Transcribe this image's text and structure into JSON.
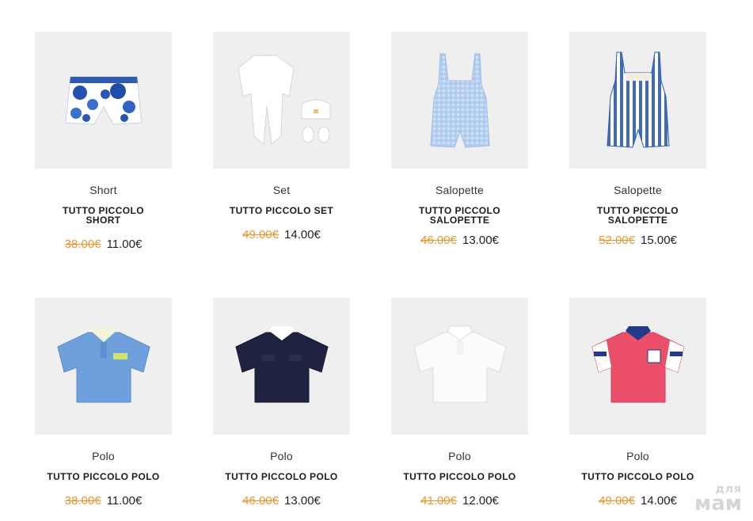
{
  "products": [
    {
      "category": "Short",
      "title": "TUTTO PICCOLO SHORT",
      "old_price": "38.00€",
      "new_price": "11.00€",
      "image": "floral-shorts-image"
    },
    {
      "category": "Set",
      "title": "TUTTO PICCOLO SET",
      "old_price": "49.00€",
      "new_price": "14.00€",
      "image": "white-babygrow-set-image"
    },
    {
      "category": "Salopette",
      "title": "TUTTO PICCOLO SALOPETTE",
      "old_price": "46.00€",
      "new_price": "13.00€",
      "image": "gingham-dungarees-image"
    },
    {
      "category": "Salopette",
      "title": "TUTTO PICCOLO SALOPETTE",
      "old_price": "52.00€",
      "new_price": "15.00€",
      "image": "striped-dungarees-image"
    },
    {
      "category": "Polo",
      "title": "TUTTO PICCOLO POLO",
      "old_price": "38.00€",
      "new_price": "11.00€",
      "image": "blue-polo-image"
    },
    {
      "category": "Polo",
      "title": "TUTTO PICCOLO POLO",
      "old_price": "46.00€",
      "new_price": "13.00€",
      "image": "navy-polo-image"
    },
    {
      "category": "Polo",
      "title": "TUTTO PICCOLO POLO",
      "old_price": "41.00€",
      "new_price": "12.00€",
      "image": "white-polo-image"
    },
    {
      "category": "Polo",
      "title": "TUTTO PICCOLO POLO",
      "old_price": "49.00€",
      "new_price": "14.00€",
      "image": "red-polo-image"
    }
  ],
  "watermark": {
    "line1": "для",
    "line2": "мам"
  },
  "colors": {
    "old_price": "#e8962f",
    "image_bg": "#efefef"
  }
}
